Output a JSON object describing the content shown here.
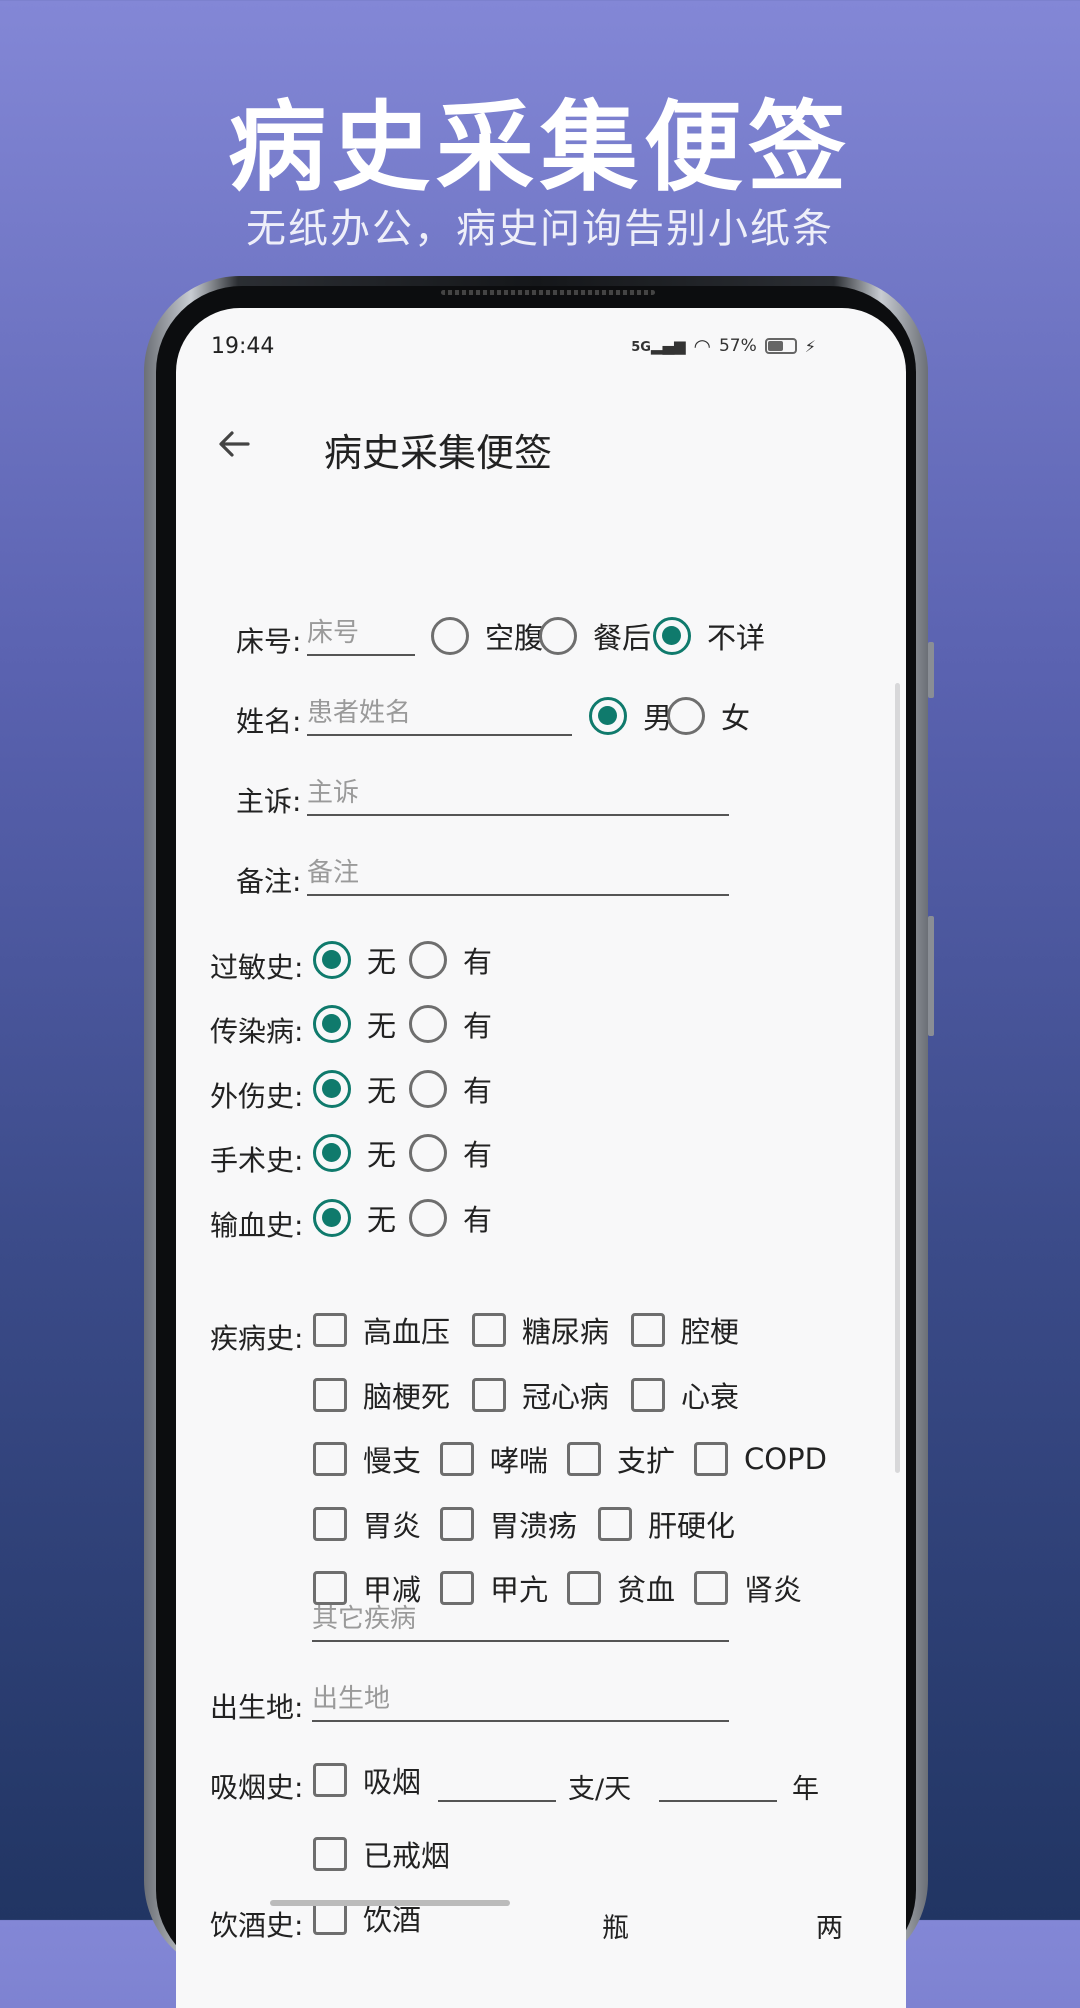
{
  "promo": {
    "title": "病史采集便签",
    "subtitle": "无纸办公，病史问询告别小纸条"
  },
  "status_bar": {
    "time": "19:44",
    "network": "5G",
    "battery": "57%",
    "battery_level": 0.57
  },
  "app_bar": {
    "title": "病史采集便签",
    "back_icon": "arrow-left-icon"
  },
  "form": {
    "bed": {
      "label": "床号:",
      "placeholder": "床号",
      "options": [
        "空腹",
        "餐后",
        "不详"
      ],
      "selected": "不详"
    },
    "name": {
      "label": "姓名:",
      "placeholder": "患者姓名",
      "options": [
        "男",
        "女"
      ],
      "selected": "男"
    },
    "complaint": {
      "label": "主诉:",
      "placeholder": "主诉"
    },
    "remark": {
      "label": "备注:",
      "placeholder": "备注"
    },
    "history_rows": [
      {
        "label": "过敏史:",
        "opt_no": "无",
        "opt_yes": "有",
        "selected": "无"
      },
      {
        "label": "传染病:",
        "opt_no": "无",
        "opt_yes": "有",
        "selected": "无"
      },
      {
        "label": "外伤史:",
        "opt_no": "无",
        "opt_yes": "有",
        "selected": "无"
      },
      {
        "label": "手术史:",
        "opt_no": "无",
        "opt_yes": "有",
        "selected": "无"
      },
      {
        "label": "输血史:",
        "opt_no": "无",
        "opt_yes": "有",
        "selected": "无"
      }
    ],
    "disease": {
      "label": "疾病史:",
      "rows": [
        [
          "高血压",
          "糖尿病",
          "腔梗"
        ],
        [
          "脑梗死",
          "冠心病",
          "心衰"
        ],
        [
          "慢支",
          "哮喘",
          "支扩",
          "COPD"
        ],
        [
          "胃炎",
          "胃溃疡",
          "肝硬化"
        ],
        [
          "甲减",
          "甲亢",
          "贫血",
          "肾炎"
        ]
      ],
      "other_placeholder": "其它疾病"
    },
    "birthplace": {
      "label": "出生地:",
      "placeholder": "出生地"
    },
    "smoking": {
      "label": "吸烟史:",
      "option": "吸烟",
      "unit1": "支/天",
      "unit2": "年",
      "quit": "已戒烟"
    },
    "drinking": {
      "label": "饮酒史:",
      "option": "饮酒",
      "unit1": "瓶",
      "unit2": "两"
    }
  }
}
